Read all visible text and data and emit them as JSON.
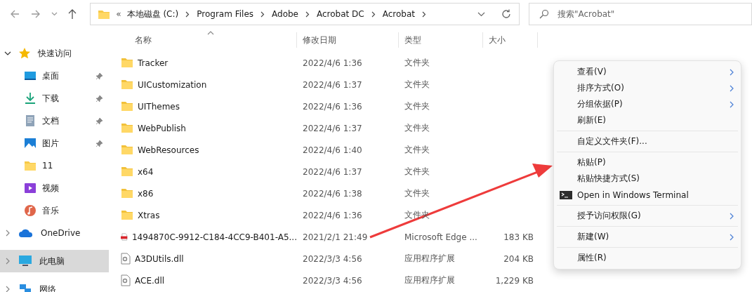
{
  "address_bar": {
    "overflow": "«",
    "crumbs": [
      "本地磁盘 (C:)",
      "Program Files",
      "Adobe",
      "Acrobat DC",
      "Acrobat"
    ]
  },
  "search": {
    "placeholder": "搜索\"Acrobat\""
  },
  "sidebar": {
    "items": [
      {
        "label": "快速访问",
        "kind": "star",
        "expanded": true,
        "selected": false,
        "children": [
          {
            "label": "桌面",
            "kind": "desktop",
            "pinned": true
          },
          {
            "label": "下载",
            "kind": "download",
            "pinned": true
          },
          {
            "label": "文档",
            "kind": "document",
            "pinned": true
          },
          {
            "label": "图片",
            "kind": "picture",
            "pinned": true
          },
          {
            "label": "11",
            "kind": "folder",
            "pinned": false
          },
          {
            "label": "视频",
            "kind": "video",
            "pinned": false
          },
          {
            "label": "音乐",
            "kind": "music",
            "pinned": false
          }
        ]
      },
      {
        "label": "OneDrive",
        "kind": "cloud",
        "expanded": false,
        "selected": false
      },
      {
        "label": "此电脑",
        "kind": "computer",
        "expanded": false,
        "selected": true
      },
      {
        "label": "网络",
        "kind": "network",
        "expanded": false,
        "selected": false
      }
    ]
  },
  "table": {
    "columns": [
      "名称",
      "修改日期",
      "类型",
      "大小"
    ],
    "rows": [
      {
        "kind": "folder",
        "name": "Tracker",
        "date": "2022/4/6 1:36",
        "type": "文件夹"
      },
      {
        "kind": "folder",
        "name": "UICustomization",
        "date": "2022/4/6 1:37",
        "type": "文件夹"
      },
      {
        "kind": "folder",
        "name": "UIThemes",
        "date": "2022/4/6 1:36",
        "type": "文件夹"
      },
      {
        "kind": "folder",
        "name": "WebPublish",
        "date": "2022/4/6 1:37",
        "type": "文件夹"
      },
      {
        "kind": "folder",
        "name": "WebResources",
        "date": "2022/4/6 1:40",
        "type": "文件夹"
      },
      {
        "kind": "folder",
        "name": "x64",
        "date": "2022/4/6 1:37",
        "type": "文件夹"
      },
      {
        "kind": "folder",
        "name": "x86",
        "date": "2022/4/6 1:38",
        "type": "文件夹"
      },
      {
        "kind": "folder",
        "name": "Xtras",
        "date": "2022/4/6 1:36",
        "type": "文件夹"
      },
      {
        "kind": "pdf",
        "name": "1494870C-9912-C184-4CC9-B401-A5...",
        "date": "2021/2/1 21:49",
        "type": "Microsoft Edge ...",
        "size": "183 KB"
      },
      {
        "kind": "dll",
        "name": "A3DUtils.dll",
        "date": "2022/3/3 4:56",
        "type": "应用程序扩展",
        "size": "204 KB"
      },
      {
        "kind": "dll",
        "name": "ACE.dll",
        "date": "2022/3/3 4:56",
        "type": "应用程序扩展",
        "size": "1,229 KB"
      }
    ]
  },
  "context_menu": {
    "items": [
      {
        "kind": "item",
        "label": "查看(V)",
        "submenu": true
      },
      {
        "kind": "item",
        "label": "排序方式(O)",
        "submenu": true
      },
      {
        "kind": "item",
        "label": "分组依据(P)",
        "submenu": true
      },
      {
        "kind": "item",
        "label": "刷新(E)",
        "submenu": false
      },
      {
        "kind": "separator"
      },
      {
        "kind": "item",
        "label": "自定义文件夹(F)...",
        "submenu": false
      },
      {
        "kind": "separator"
      },
      {
        "kind": "item",
        "label": "粘贴(P)",
        "submenu": false
      },
      {
        "kind": "item",
        "label": "粘贴快捷方式(S)",
        "submenu": false
      },
      {
        "kind": "terminal",
        "label": "Open in Windows Terminal",
        "submenu": false
      },
      {
        "kind": "separator"
      },
      {
        "kind": "item",
        "label": "授予访问权限(G)",
        "submenu": true
      },
      {
        "kind": "separator"
      },
      {
        "kind": "item",
        "label": "新建(W)",
        "submenu": true
      },
      {
        "kind": "separator"
      },
      {
        "kind": "item",
        "label": "属性(R)",
        "submenu": false
      }
    ]
  }
}
